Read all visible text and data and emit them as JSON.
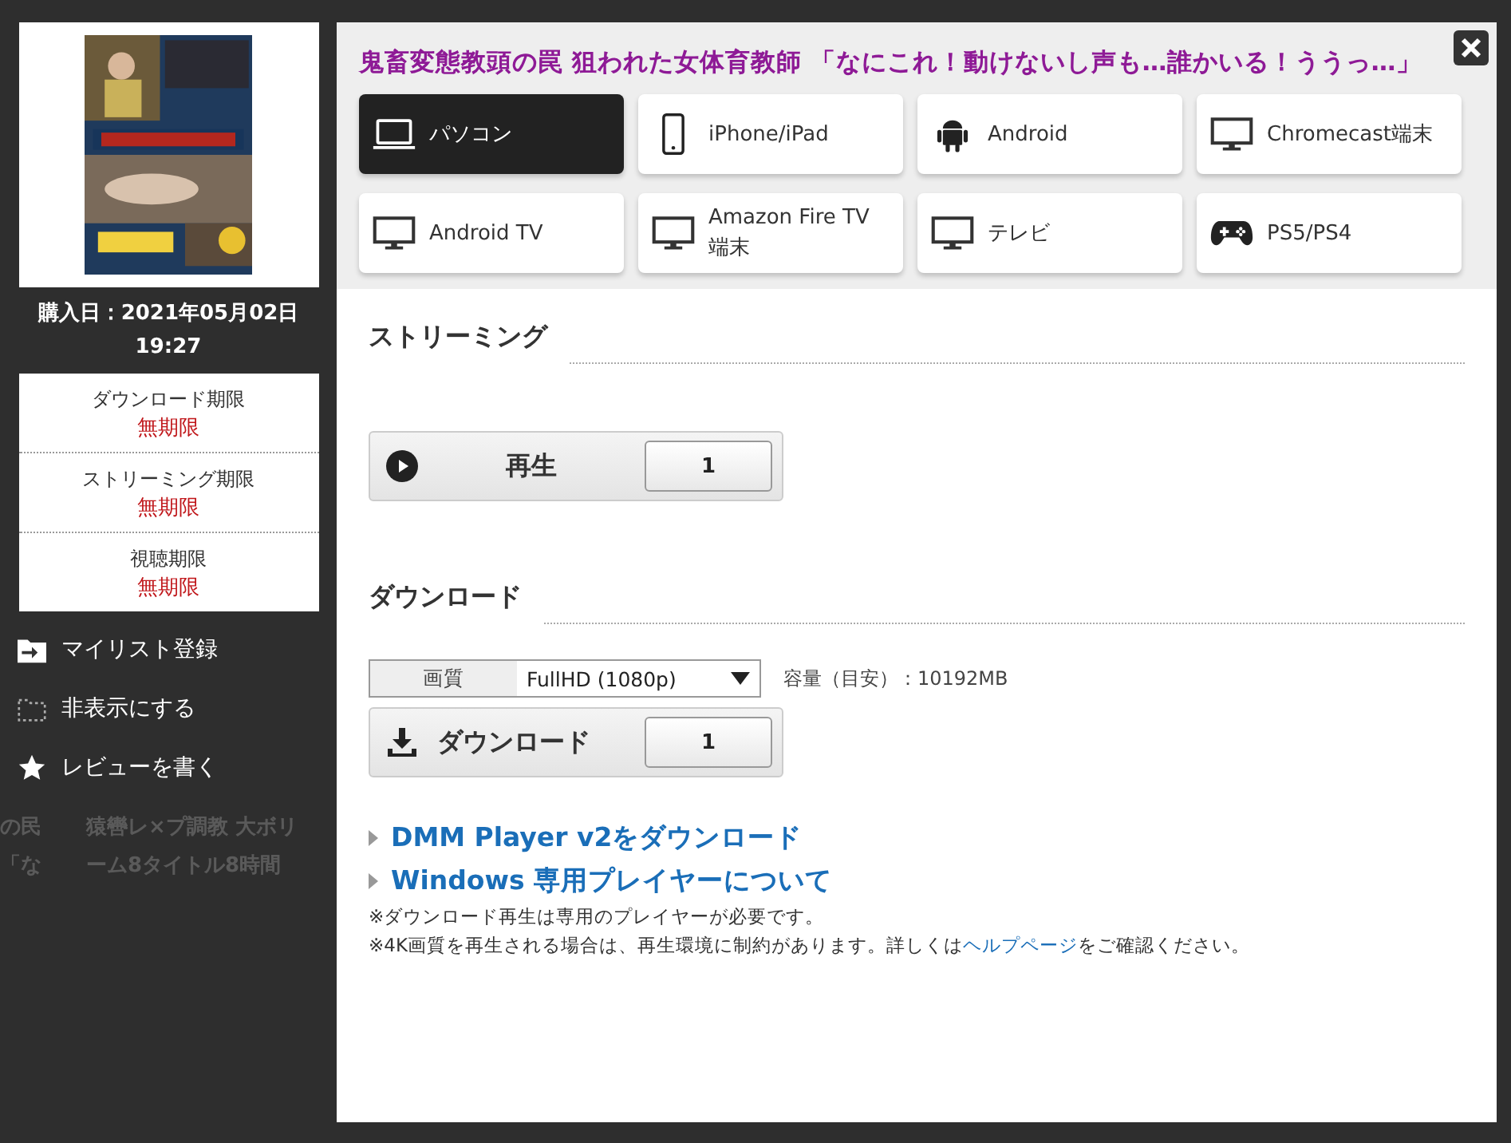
{
  "sidebar": {
    "purchase_date": "購入日：2021年05月02日 19:27",
    "periods": [
      {
        "label": "ダウンロード期限",
        "value": "無期限"
      },
      {
        "label": "ストリーミング期限",
        "value": "無期限"
      },
      {
        "label": "視聴期限",
        "value": "無期限"
      }
    ],
    "actions": [
      {
        "kind": "mylist",
        "label": "マイリスト登録"
      },
      {
        "kind": "hide",
        "label": "非表示にする"
      },
      {
        "kind": "review",
        "label": "レビューを書く"
      }
    ]
  },
  "background_texts": [
    {
      "left": "の民",
      "right": "猿轡レ×プ調教 大ボリ"
    },
    {
      "left": "「な",
      "right": "ーム8タイトル8時間"
    }
  ],
  "title": "鬼畜変態教頭の罠 狙われた女体育教師 「なにこれ！動けないし声も…誰かいる！ううっ…」",
  "devices": [
    {
      "kind": "laptop",
      "label": "パソコン",
      "selected": true
    },
    {
      "kind": "phone",
      "label": "iPhone/iPad",
      "selected": false
    },
    {
      "kind": "android",
      "label": "Android",
      "selected": false
    },
    {
      "kind": "tv",
      "label": "Chromecast端末",
      "selected": false
    },
    {
      "kind": "tv",
      "label": "Android TV",
      "selected": false
    },
    {
      "kind": "tv",
      "label": "Amazon Fire TV 端末",
      "selected": false
    },
    {
      "kind": "tv",
      "label": "テレビ",
      "selected": false
    },
    {
      "kind": "gamepad",
      "label": "PS5/PS4",
      "selected": false
    }
  ],
  "streaming": {
    "heading": "ストリーミング",
    "button": "再生",
    "count": "1"
  },
  "download": {
    "heading": "ダウンロード",
    "quality_label": "画質",
    "quality": "FullHD (1080p)",
    "size": "容量（目安）：10192MB",
    "button": "ダウンロード",
    "count": "1"
  },
  "links": [
    "DMM Player v2をダウンロード",
    "Windows 専用プレイヤーについて"
  ],
  "notes": [
    {
      "text": "※ダウンロード再生は専用のプレイヤーが必要です。"
    },
    {
      "text": "※4K画質を再生される場合は、再生環境に制約があります。詳しくは",
      "link": "ヘルプページ",
      "text_after": "をご確認ください。"
    }
  ]
}
